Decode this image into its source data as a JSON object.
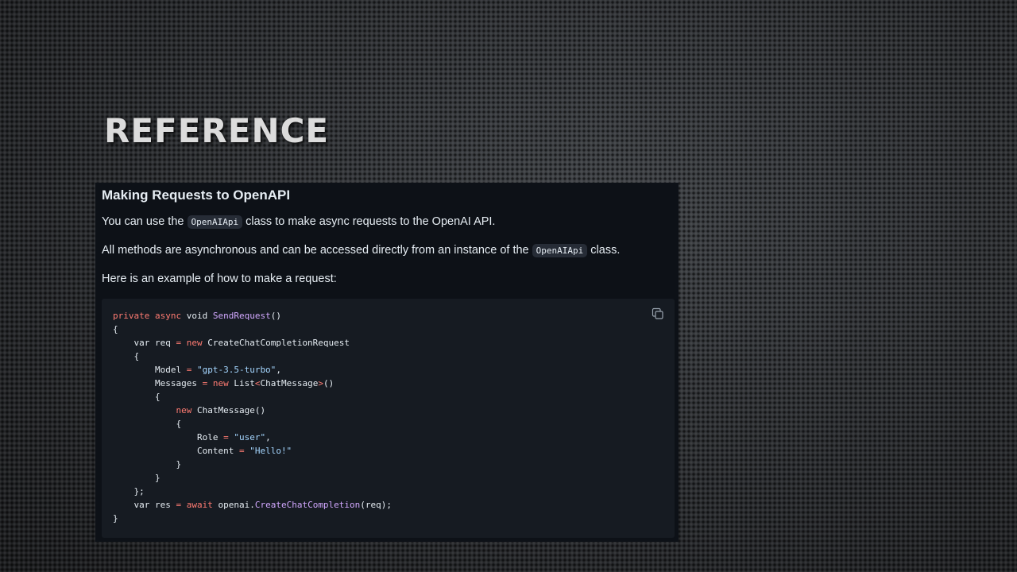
{
  "slide": {
    "title": "REFERENCE"
  },
  "doc": {
    "heading": "Making Requests to OpenAPI",
    "para1_before": "You can use the ",
    "para1_code": "OpenAIApi",
    "para1_after": " class to make async requests to the OpenAI API.",
    "para2_before": "All methods are asynchronous and can be accessed directly from an instance of the ",
    "para2_code": "OpenAIApi",
    "para2_after": " class.",
    "para3": "Here is an example of how to make a request:"
  },
  "code_block": {
    "copy_icon": "copy-icon",
    "lines": [
      [
        {
          "t": "private async",
          "c": "kw"
        },
        {
          "t": " void "
        },
        {
          "t": "SendRequest",
          "c": "fn"
        },
        {
          "t": "()"
        }
      ],
      [
        {
          "t": "{"
        }
      ],
      [
        {
          "t": "    var req "
        },
        {
          "t": "=",
          "c": "op"
        },
        {
          "t": " "
        },
        {
          "t": "new",
          "c": "kw"
        },
        {
          "t": " CreateChatCompletionRequest"
        }
      ],
      [
        {
          "t": "    {"
        }
      ],
      [
        {
          "t": "        Model "
        },
        {
          "t": "=",
          "c": "op"
        },
        {
          "t": " "
        },
        {
          "t": "\"gpt-3.5-turbo\"",
          "c": "str"
        },
        {
          "t": ","
        }
      ],
      [
        {
          "t": "        Messages "
        },
        {
          "t": "=",
          "c": "op"
        },
        {
          "t": " "
        },
        {
          "t": "new",
          "c": "kw"
        },
        {
          "t": " List"
        },
        {
          "t": "<",
          "c": "op"
        },
        {
          "t": "ChatMessage"
        },
        {
          "t": ">",
          "c": "op"
        },
        {
          "t": "()"
        }
      ],
      [
        {
          "t": "        {"
        }
      ],
      [
        {
          "t": "            "
        },
        {
          "t": "new",
          "c": "kw"
        },
        {
          "t": " ChatMessage()"
        }
      ],
      [
        {
          "t": "            {"
        }
      ],
      [
        {
          "t": "                Role "
        },
        {
          "t": "=",
          "c": "op"
        },
        {
          "t": " "
        },
        {
          "t": "\"user\"",
          "c": "str"
        },
        {
          "t": ","
        }
      ],
      [
        {
          "t": "                Content "
        },
        {
          "t": "=",
          "c": "op"
        },
        {
          "t": " "
        },
        {
          "t": "\"Hello!\"",
          "c": "str"
        }
      ],
      [
        {
          "t": "            }"
        }
      ],
      [
        {
          "t": "        }"
        }
      ],
      [
        {
          "t": "    };"
        }
      ],
      [
        {
          "t": "    var res "
        },
        {
          "t": "=",
          "c": "op"
        },
        {
          "t": " "
        },
        {
          "t": "await",
          "c": "kw"
        },
        {
          "t": " openai."
        },
        {
          "t": "CreateChatCompletion",
          "c": "fn"
        },
        {
          "t": "(req);"
        }
      ],
      [
        {
          "t": "}"
        }
      ]
    ]
  },
  "colors": {
    "keyword": "#ff7b72",
    "function": "#d2a8ff",
    "string": "#a5d6ff",
    "panel_bg": "#0d1117",
    "code_bg": "#161b22"
  }
}
